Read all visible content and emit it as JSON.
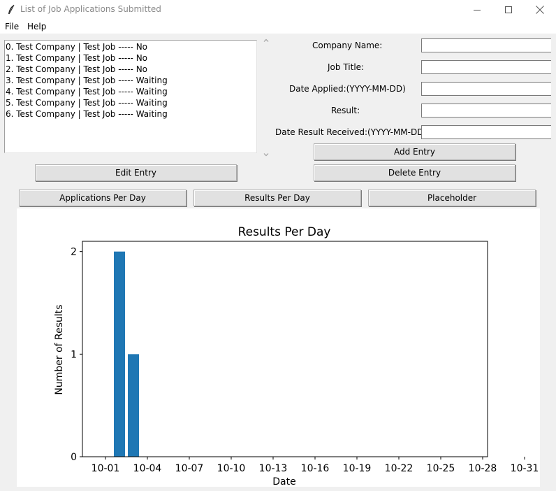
{
  "window": {
    "title": "List of Job Applications Submitted"
  },
  "menu": {
    "items": [
      {
        "label": "File"
      },
      {
        "label": "Help"
      }
    ]
  },
  "listbox": {
    "items": [
      {
        "text": "0. Test Company | Test Job ----- No"
      },
      {
        "text": "1. Test Company | Test Job ----- No"
      },
      {
        "text": "2. Test Company | Test Job ----- No"
      },
      {
        "text": "3. Test Company | Test Job ----- Waiting"
      },
      {
        "text": "4. Test Company | Test Job ----- Waiting"
      },
      {
        "text": "5. Test Company | Test Job ----- Waiting"
      },
      {
        "text": "6. Test Company | Test Job ----- Waiting"
      }
    ]
  },
  "form": {
    "company_label": "Company Name:",
    "company_value": "",
    "title_label": "Job Title:",
    "title_value": "",
    "date_applied_label": "Date Applied:(YYYY-MM-DD)",
    "date_applied_value": "",
    "result_label": "Result:",
    "result_value": "",
    "date_result_label": "Date Result Received:(YYYY-MM-DD)",
    "date_result_value": ""
  },
  "buttons": {
    "add": "Add Entry",
    "edit": "Edit Entry",
    "delete": "Delete Entry",
    "apps_per_day": "Applications Per Day",
    "results_per_day": "Results Per Day",
    "placeholder": "Placeholder"
  },
  "colors": {
    "bar": "#1f77b4"
  },
  "chart_data": {
    "type": "bar",
    "title": "Results Per Day",
    "xlabel": "Date",
    "ylabel": "Number of Results",
    "x_tick_labels": [
      "10-01",
      "10-04",
      "10-07",
      "10-10",
      "10-13",
      "10-16",
      "10-19",
      "10-22",
      "10-25",
      "10-28",
      "10-31"
    ],
    "y_tick_labels": [
      "0",
      "1",
      "2"
    ],
    "x_dates": [
      "10-02",
      "10-03"
    ],
    "values": [
      2,
      1
    ],
    "ylim": [
      0,
      2.1
    ],
    "grid": false
  }
}
